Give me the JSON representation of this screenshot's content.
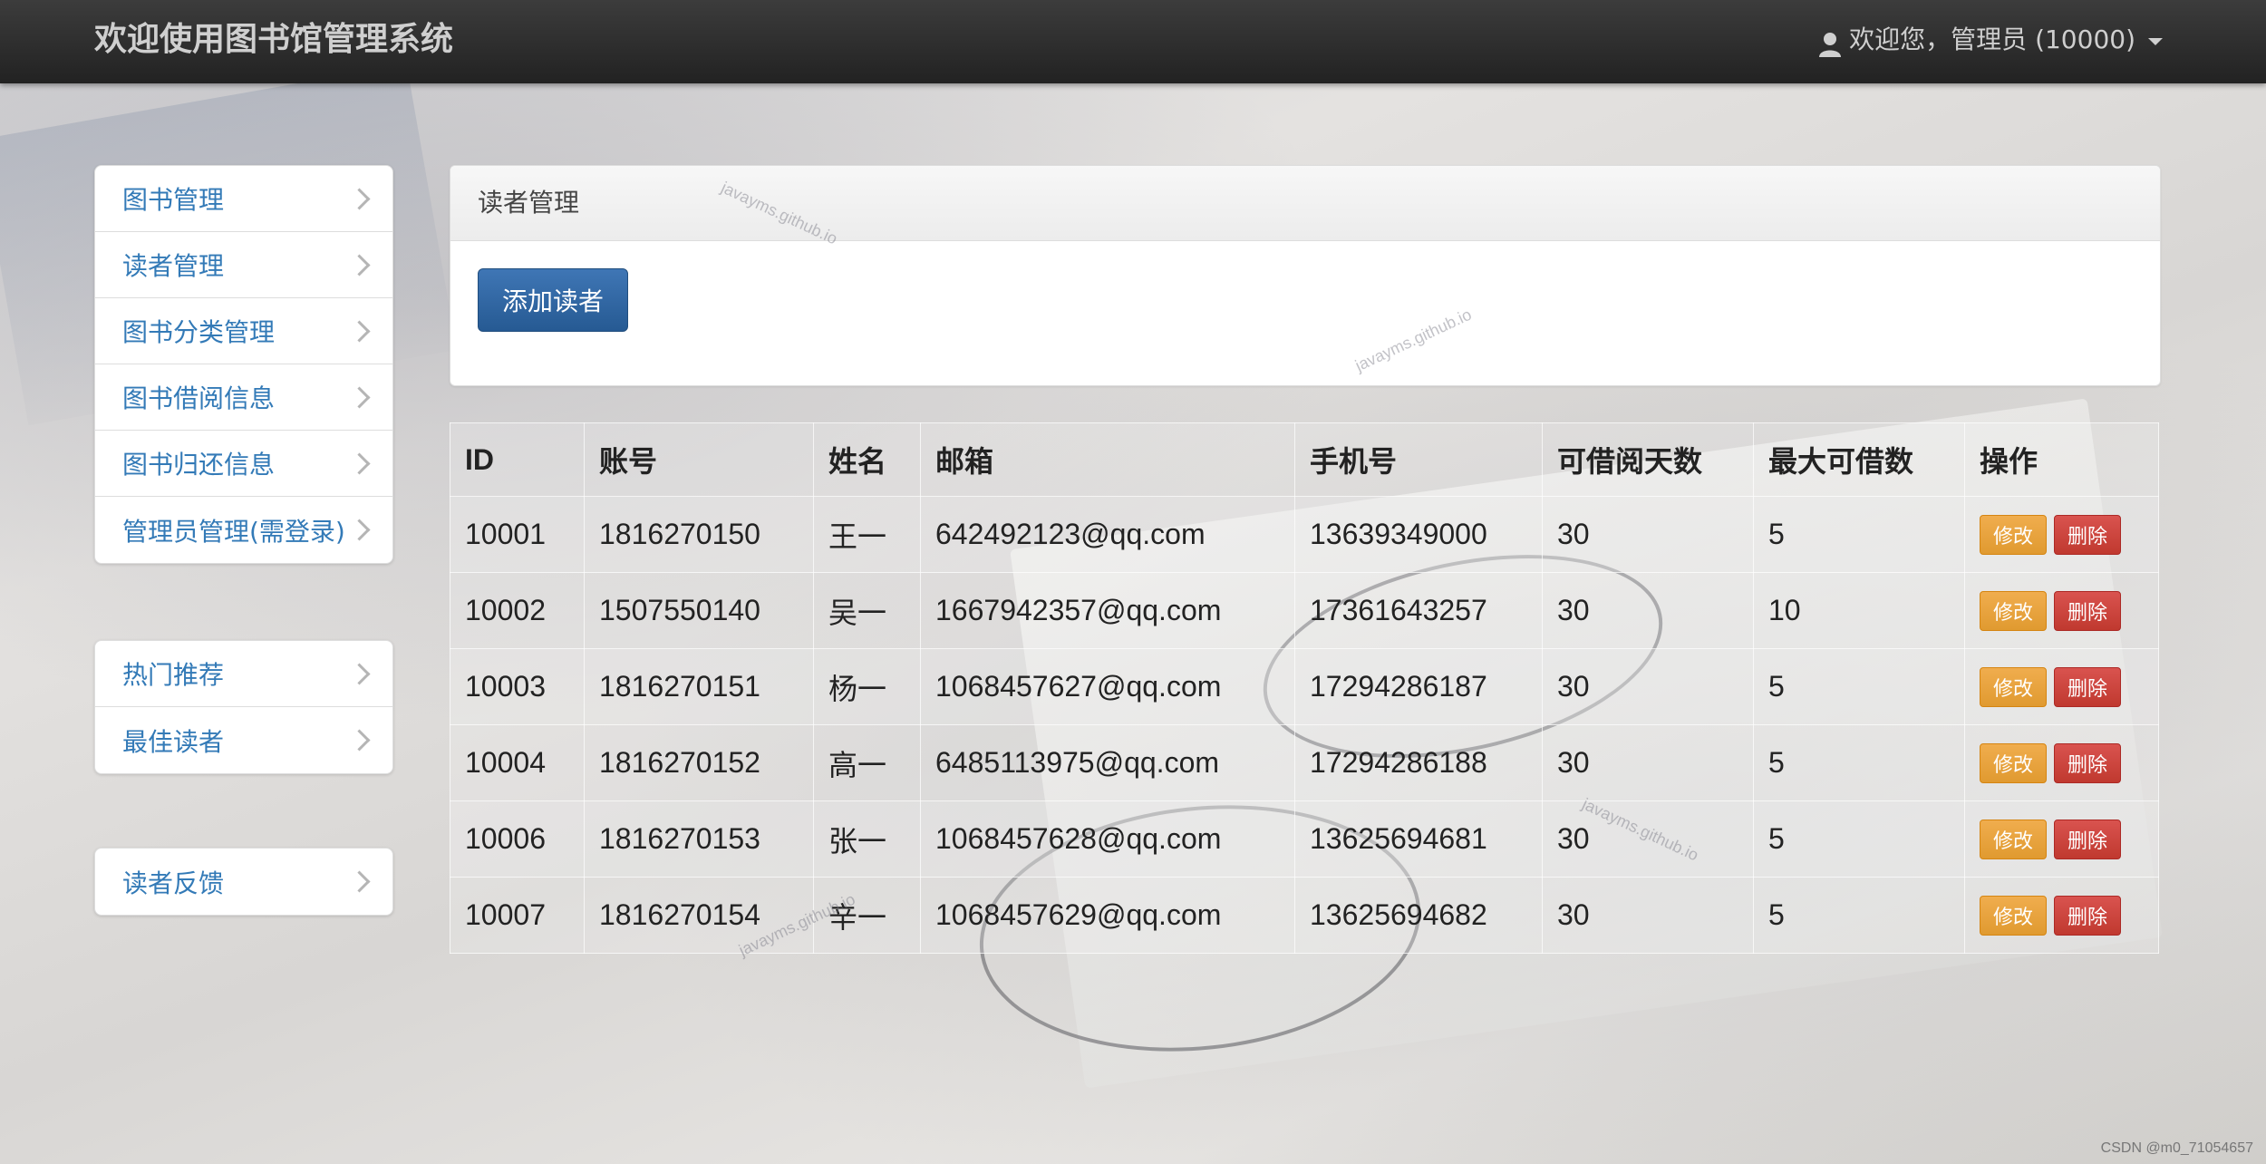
{
  "navbar": {
    "brand": "欢迎使用图书馆管理系统",
    "user_label": "欢迎您，管理员 (10000)",
    "user_icon": "user-icon",
    "dropdown_icon": "caret-down-icon"
  },
  "sidebar": {
    "group1": [
      {
        "label": "图书管理"
      },
      {
        "label": "读者管理"
      },
      {
        "label": "图书分类管理"
      },
      {
        "label": "图书借阅信息"
      },
      {
        "label": "图书归还信息"
      },
      {
        "label": "管理员管理(需登录)"
      }
    ],
    "group2": [
      {
        "label": "热门推荐"
      },
      {
        "label": "最佳读者"
      }
    ],
    "group3": [
      {
        "label": "读者反馈"
      }
    ]
  },
  "panel": {
    "title": "读者管理",
    "add_button": "添加读者"
  },
  "table": {
    "headers": [
      "ID",
      "账号",
      "姓名",
      "邮箱",
      "手机号",
      "可借阅天数",
      "最大可借数",
      "操作"
    ],
    "rows": [
      {
        "id": "10001",
        "account": "1816270150",
        "name": "王一",
        "email": "642492123@qq.com",
        "phone": "13639349000",
        "days": "30",
        "max": "5"
      },
      {
        "id": "10002",
        "account": "1507550140",
        "name": "吴一",
        "email": "1667942357@qq.com",
        "phone": "17361643257",
        "days": "30",
        "max": "10"
      },
      {
        "id": "10003",
        "account": "1816270151",
        "name": "杨一",
        "email": "1068457627@qq.com",
        "phone": "17294286187",
        "days": "30",
        "max": "5"
      },
      {
        "id": "10004",
        "account": "1816270152",
        "name": "高一",
        "email": "6485113975@qq.com",
        "phone": "17294286188",
        "days": "30",
        "max": "5"
      },
      {
        "id": "10006",
        "account": "1816270153",
        "name": "张一",
        "email": "1068457628@qq.com",
        "phone": "13625694681",
        "days": "30",
        "max": "5"
      },
      {
        "id": "10007",
        "account": "1816270154",
        "name": "辛一",
        "email": "1068457629@qq.com",
        "phone": "13625694682",
        "days": "30",
        "max": "5"
      }
    ],
    "edit_label": "修改",
    "delete_label": "删除"
  },
  "watermark": "javayms.github.io",
  "footer_mark": "CSDN @m0_71054657",
  "colors": {
    "link": "#337ab7",
    "primary": "#2d6aa8",
    "warning": "#f0ad4e",
    "danger": "#d9534f",
    "navbar": "#2a2a2a"
  }
}
